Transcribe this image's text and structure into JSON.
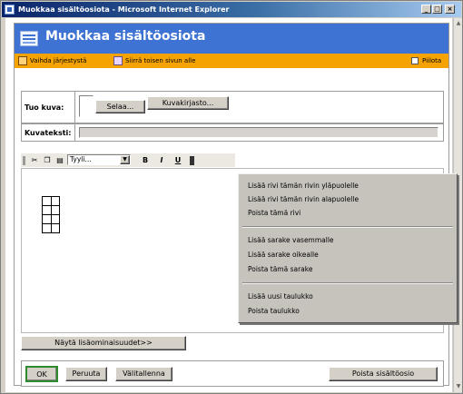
{
  "window": {
    "title": "Muokkaa sisältöosiota - Microsoft Internet Explorer",
    "buttons": [
      "_",
      "□",
      "×"
    ]
  },
  "header": {
    "title": "Muokkaa sisältöosiota",
    "logo_icon": "content-logo-icon"
  },
  "toolbar": {
    "reorder_label": "Vaihda järjestystä",
    "move_label": "Siirrä toisen sivun alle",
    "hide_label": "Piilota"
  },
  "image": {
    "label": "Tuo kuva:",
    "browse_label": "Selaa...",
    "library_label": "Kuvakirjasto...",
    "caption_label": "Kuvateksti:",
    "caption_value": ""
  },
  "editor": {
    "style_select": "Tyyli...",
    "bold": "B",
    "italic": "I",
    "underline": "U"
  },
  "context_menu": {
    "items": [
      "Lisää rivi tämän rivin yläpuolelle",
      "Lisää rivi tämän rivin alapuolelle",
      "Poista tämä rivi",
      "Lisää sarake vasemmalle",
      "Lisää sarake oikealle",
      "Poista tämä sarake",
      "Lisää uusi taulukko",
      "Poista taulukko"
    ]
  },
  "more": {
    "label": "Näytä lisäominaisuudet>>"
  },
  "actions": {
    "ok": "OK",
    "cancel": "Peruuta",
    "save_draft": "Välitallenna",
    "delete": "Poista sisältöosio"
  },
  "colors": {
    "header_blue": "#3f73d3",
    "toolbar_orange": "#f5a300",
    "ok_border": "#2e8b2e"
  }
}
